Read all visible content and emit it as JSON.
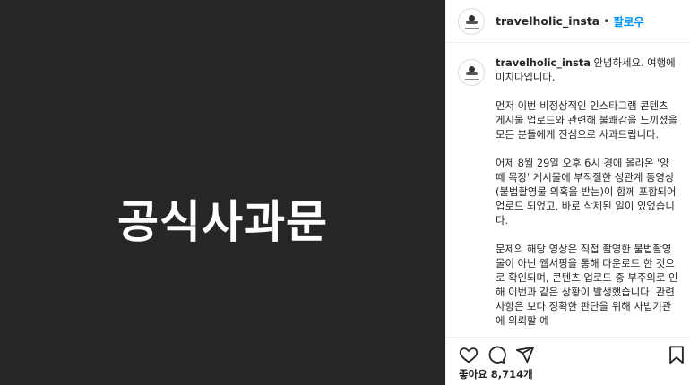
{
  "media": {
    "overlay_text": "공식사과문"
  },
  "header": {
    "username": "travelholic_insta",
    "separator": "•",
    "follow_label": "팔로우"
  },
  "caption": {
    "username": "travelholic_insta",
    "greeting": "안녕하세요. 여행에 미치다입니다.",
    "paragraphs": [
      "먼저 이번 비정상적인 인스타그램 콘텐츠 게시물 업로드와 관련해 불쾌감을 느끼셨을 모든 분들에게 진심으로 사과드립니다.",
      "어제 8월 29일 오후 6시 경에 올라온 '양떼 목장' 게시물에 부적절한 성관계 동영상(불법촬영물 의혹을 받는)이 함께 포함되어 업로드 되었고, 바로 삭제된 일이 있었습니다.",
      "문제의 해당 영상은 직접 촬영한 불법촬영물이 아닌 웹서핑을 통해 다운로드 한 것으로 확인되며, 콘텐츠 업로드 중 부주의로 인해 이번과 같은 상황이 발생했습니다. 관련 사항은 보다 정확한 판단을 위해 사법기관에 의뢰할 예"
    ]
  },
  "actions": {
    "icons": [
      "heart-icon",
      "comment-icon",
      "share-icon",
      "bookmark-icon"
    ]
  },
  "likes": {
    "label": "좋아요 8,714개"
  }
}
